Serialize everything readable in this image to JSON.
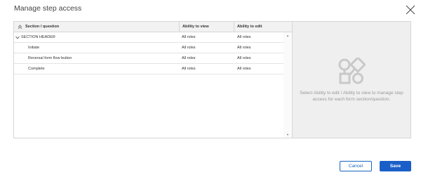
{
  "dialog": {
    "title": "Manage step access"
  },
  "table": {
    "columns": {
      "section": "Section / question",
      "view": "Ability to view",
      "edit": "Ability to edit"
    },
    "rows": [
      {
        "label": "SECTION HEADER",
        "view": "All roles",
        "edit": "All roles"
      },
      {
        "label": "Initiate",
        "view": "All roles",
        "edit": "All roles"
      },
      {
        "label": "Reversal form flow button",
        "view": "All roles",
        "edit": "All roles"
      },
      {
        "label": "Complete",
        "view": "All roles",
        "edit": "All roles"
      }
    ]
  },
  "empty_panel": {
    "message": "Select Ability to edit / Ability to view to manage step access for each form section/question.",
    "icon": "workflow-shapes-icon"
  },
  "buttons": {
    "cancel": "Cancel",
    "save": "Save"
  },
  "colors": {
    "primary": "#1a5fc8",
    "panel_bg": "#efefef",
    "header_bg": "#f2f2f2"
  }
}
